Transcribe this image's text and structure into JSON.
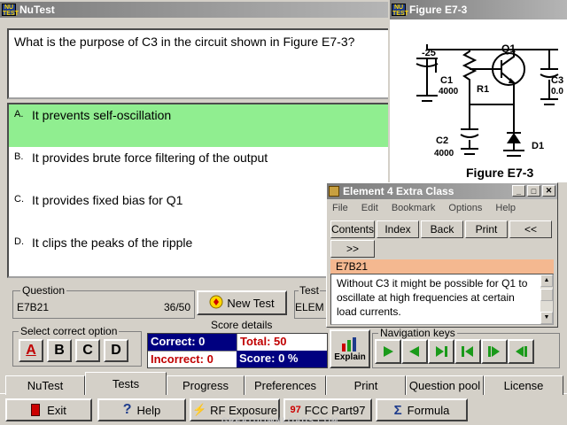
{
  "main_window": {
    "title": "NuTest"
  },
  "question": {
    "text": "What is the purpose of C3 in the circuit shown in Figure E7-3?",
    "answers": [
      {
        "letter": "A.",
        "text": "It prevents self-oscillation",
        "selected": true
      },
      {
        "letter": "B.",
        "text": "It provides brute force filtering of the output",
        "selected": false
      },
      {
        "letter": "C.",
        "text": "It provides fixed bias for Q1",
        "selected": false
      },
      {
        "letter": "D.",
        "text": "It clips the peaks of the ripple",
        "selected": false
      }
    ]
  },
  "question_info": {
    "group_label": "Question",
    "id": "E7B21",
    "progress": "36/50"
  },
  "new_test": {
    "label": "New Test"
  },
  "test_group": {
    "label": "Test",
    "value": "ELEM"
  },
  "select_option": {
    "label": "Select correct option",
    "options": [
      "A",
      "B",
      "C",
      "D"
    ]
  },
  "score": {
    "label": "Score details",
    "correct": "Correct: 0",
    "total": "Total: 50",
    "incorrect": "Incorrect: 0",
    "score": "Score: 0 %"
  },
  "explain": {
    "label": "Explain"
  },
  "nav": {
    "label": "Navigation keys"
  },
  "tabs": [
    "NuTest",
    "Tests",
    "Progress",
    "Preferences",
    "Print",
    "Question pool",
    "License"
  ],
  "bottom_buttons": {
    "exit": "Exit",
    "help": "Help",
    "rf": "RF Exposure",
    "fcc": "FCC Part97",
    "formula": "Formula",
    "fcc_badge": "97"
  },
  "figure": {
    "window_title": "Figure E7-3",
    "caption": "Figure E7-3",
    "labels": {
      "v": "-25",
      "q1": "Q1",
      "c1": "C1",
      "c1v": "4000",
      "r1": "R1",
      "c2": "C2",
      "c2v": "4000",
      "c3": "C3",
      "c3v": "0.0",
      "d1": "D1"
    }
  },
  "helpwin": {
    "title": "Element 4 Extra Class",
    "menu": [
      "File",
      "Edit",
      "Bookmark",
      "Options",
      "Help"
    ],
    "toolbar": [
      "Contents",
      "Index",
      "Back",
      "Print",
      "<<",
      ">>"
    ],
    "topic": "E7B21",
    "body": "Without C3 it might be possible for Q1 to oscillate at high frequencies at certain load currents."
  },
  "watermark": "GREATDOWNLOADS.COM",
  "colors": {
    "selected": "#90ee90",
    "navy": "#000080",
    "help_topic": "#f4b890",
    "nav_green": "#1a9a1a"
  }
}
